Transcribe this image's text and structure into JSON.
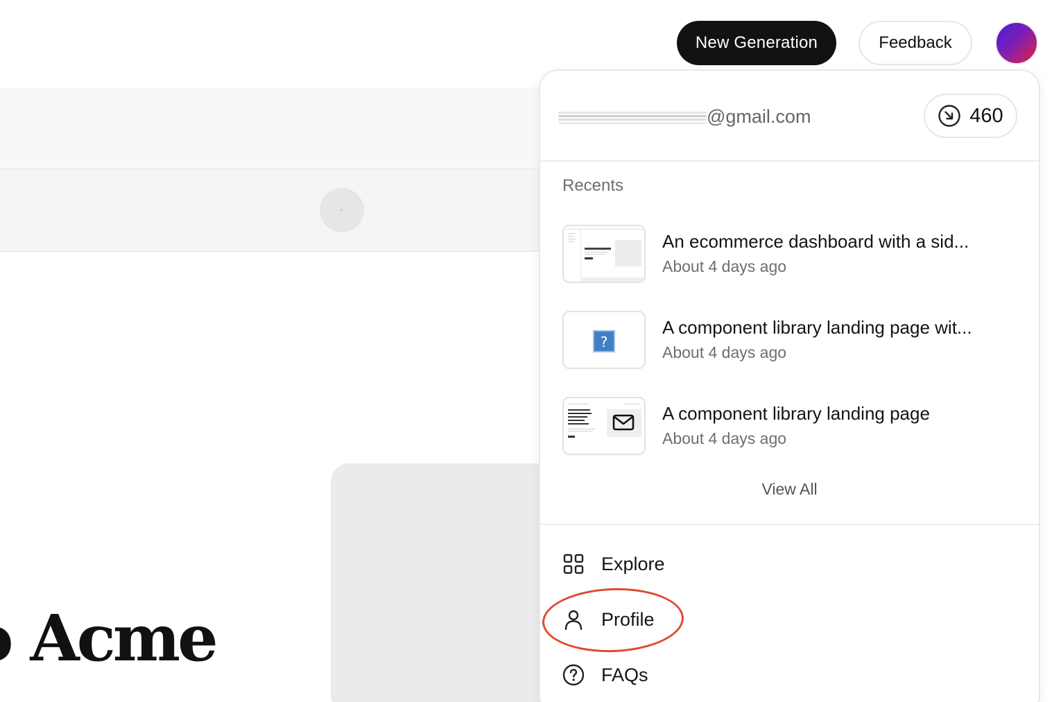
{
  "background": {
    "heading_fragment": "o Acme"
  },
  "topbar": {
    "new_generation_label": "New Generation",
    "feedback_label": "Feedback"
  },
  "menu": {
    "email_visible_part": "@gmail.com",
    "credits": "460",
    "recents_label": "Recents",
    "recents": [
      {
        "title": "An ecommerce dashboard with a sid...",
        "time": "About 4 days ago"
      },
      {
        "title": "A component library landing page wit...",
        "time": "About 4 days ago"
      },
      {
        "title": "A component library landing page",
        "time": "About 4 days ago"
      }
    ],
    "view_all_label": "View All",
    "nav": [
      {
        "label": "Explore",
        "icon": "grid-icon"
      },
      {
        "label": "Profile",
        "icon": "user-icon"
      },
      {
        "label": "FAQs",
        "icon": "question-circle-icon"
      }
    ],
    "thumb_texts": {
      "thumb1_heading": "Welcome to Acme Inc",
      "thumb3_heading": "Speed up your workflow with beautifully designed components"
    }
  },
  "colors": {
    "primary_button": "#121212",
    "highlight": "#e04a2f"
  }
}
